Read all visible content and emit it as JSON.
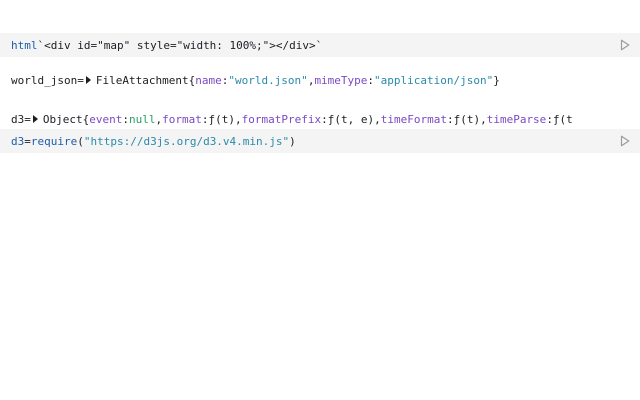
{
  "cells": {
    "html_cell": {
      "tag": "html",
      "template": "`<div id=\"map\" style=\"width: 100%;\"></div>`"
    },
    "world_json_cell": {
      "name": "world_json",
      "equals": " = ",
      "type": "FileAttachment",
      "open": " {",
      "name_key": "name",
      "name_val": "\"world.json\"",
      "mime_key": "mimeType",
      "mime_val": "\"application/json\"",
      "close": "}"
    },
    "d3_output_cell": {
      "name": "d3",
      "equals": " = ",
      "type": "Object",
      "open": " {",
      "event_key": "event",
      "event_val": "null",
      "format_key": "format",
      "format_val": "ƒ(t)",
      "formatPrefix_key": "formatPrefix",
      "formatPrefix_val": "ƒ(t, e)",
      "timeFormat_key": "timeFormat",
      "timeFormat_val": "ƒ(t)",
      "timeParse_key": "timeParse",
      "timeParse_val": "ƒ(t"
    },
    "d3_input_cell": {
      "name": "d3",
      "equals": " = ",
      "fn": "require",
      "open": "(",
      "url": "\"https://d3js.org/d3.v4.min.js\"",
      "close": ")"
    }
  },
  "icons": {
    "run": "play-icon",
    "expand": "caret-right-icon"
  },
  "colors": {
    "function": "#1d5da9",
    "string": "#2a8aa8",
    "key": "#7a49c4",
    "null": "#2d9d6b",
    "cell_background": "#f4f4f5"
  }
}
